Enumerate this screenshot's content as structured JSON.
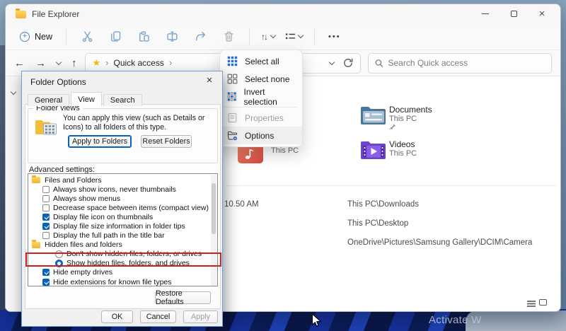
{
  "window": {
    "title": "File Explorer"
  },
  "icons": {
    "back": "←",
    "forward": "→",
    "up": "↑",
    "chevron_right": "›",
    "star": "★",
    "updown": "↑↓",
    "more_dots": "•••",
    "close": "×",
    "plus": "+"
  },
  "toolbar": {
    "new_label": "New"
  },
  "breadcrumb": {
    "location": "Quick access"
  },
  "search": {
    "placeholder": "Search Quick access"
  },
  "menu": {
    "items": [
      {
        "label": "Select all",
        "enabled": true
      },
      {
        "label": "Select none",
        "enabled": true
      },
      {
        "label": "Invert selection",
        "enabled": true
      },
      {
        "label": "Properties",
        "enabled": false
      },
      {
        "label": "Options",
        "enabled": true,
        "hovered": true
      }
    ]
  },
  "content": {
    "tiles": {
      "music": {
        "location": "This PC"
      },
      "documents": {
        "name": "Documents",
        "location": "This PC",
        "pinned": true
      },
      "videos": {
        "name": "Videos",
        "location": "This PC"
      }
    },
    "recent": [
      {
        "time": "10.50 AM",
        "path": "This PC\\Downloads"
      },
      {
        "time": "",
        "path": "This PC\\Desktop"
      },
      {
        "time": "",
        "path": "OneDrive\\Pictures\\Samsung Gallery\\DCIM\\Camera"
      }
    ]
  },
  "dialog": {
    "title": "Folder Options",
    "tabs": [
      {
        "label": "General",
        "active": false
      },
      {
        "label": "View",
        "active": true
      },
      {
        "label": "Search",
        "active": false
      }
    ],
    "folder_views": {
      "group_label": "Folder views",
      "description": "You can apply this view (such as Details or Icons) to all folders of this type.",
      "apply_button": "Apply to Folders",
      "reset_button": "Reset Folders"
    },
    "advanced": {
      "label": "Advanced settings:",
      "items": [
        {
          "type": "group",
          "label": "Files and Folders"
        },
        {
          "type": "checkbox",
          "checked": false,
          "label": "Always show icons, never thumbnails"
        },
        {
          "type": "checkbox",
          "checked": false,
          "label": "Always show menus"
        },
        {
          "type": "checkbox",
          "checked": false,
          "label": "Decrease space between items (compact view)"
        },
        {
          "type": "checkbox",
          "checked": true,
          "label": "Display file icon on thumbnails"
        },
        {
          "type": "checkbox",
          "checked": true,
          "label": "Display file size information in folder tips"
        },
        {
          "type": "checkbox",
          "checked": false,
          "label": "Display the full path in the title bar"
        },
        {
          "type": "group",
          "label": "Hidden files and folders"
        },
        {
          "type": "radio",
          "checked": false,
          "label": "Don't show hidden files, folders, or drives"
        },
        {
          "type": "radio",
          "checked": true,
          "label": "Show hidden files, folders, and drives",
          "highlighted": true
        },
        {
          "type": "checkbox",
          "checked": true,
          "label": "Hide empty drives"
        },
        {
          "type": "checkbox",
          "checked": true,
          "label": "Hide extensions for known file types"
        }
      ]
    },
    "restore_button": "Restore Defaults",
    "buttons": {
      "ok": "OK",
      "cancel": "Cancel",
      "apply": "Apply",
      "apply_enabled": false
    }
  },
  "desktop": {
    "watermark": "Activate W",
    "accent_color": "#0b63b8",
    "highlight_color": "#d21e22"
  }
}
